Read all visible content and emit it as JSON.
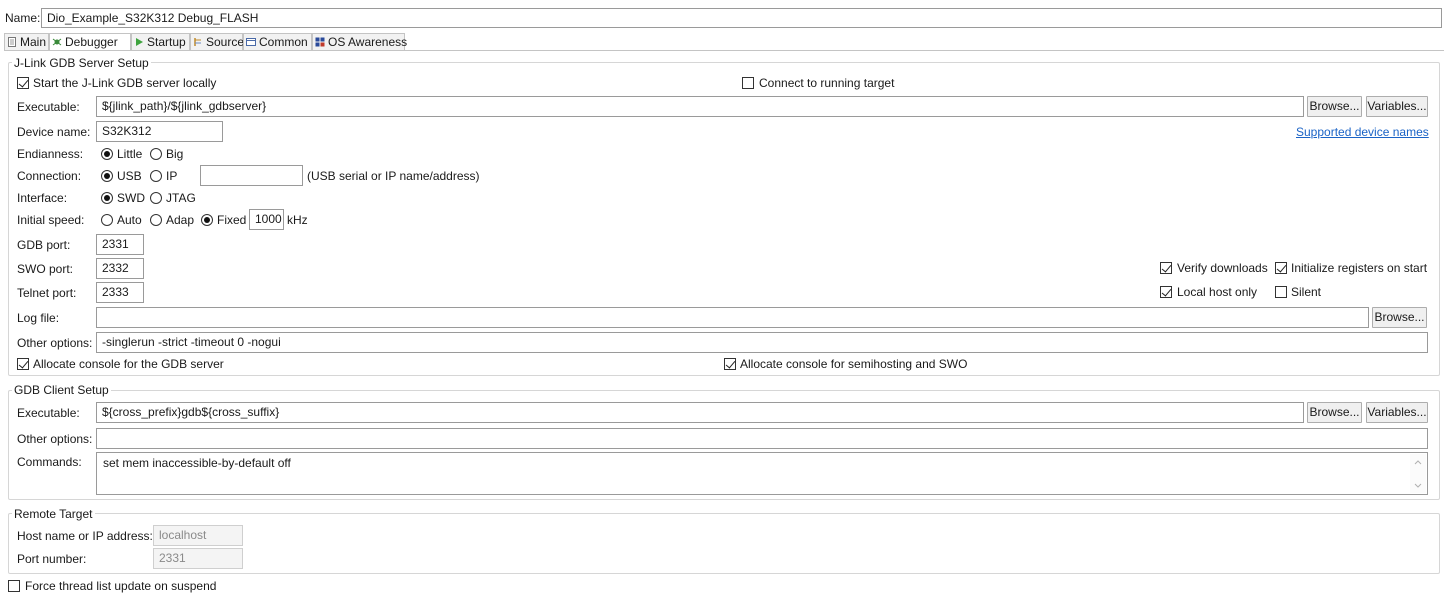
{
  "name": {
    "label": "Name:",
    "value": "Dio_Example_S32K312 Debug_FLASH"
  },
  "tabs": [
    {
      "label": "Main",
      "icon": "main-tab-icon"
    },
    {
      "label": "Debugger",
      "icon": "debugger-tab-icon"
    },
    {
      "label": "Startup",
      "icon": "startup-tab-icon"
    },
    {
      "label": "Source",
      "icon": "source-tab-icon"
    },
    {
      "label": "Common",
      "icon": "common-tab-icon"
    },
    {
      "label": "OS Awareness",
      "icon": "os-awareness-tab-icon"
    }
  ],
  "active_tab": "Debugger",
  "server": {
    "legend": "J-Link GDB Server Setup",
    "start_locally": {
      "label": "Start the J-Link GDB server locally",
      "checked": true
    },
    "connect_running": {
      "label": "Connect to running target",
      "checked": false
    },
    "executable": {
      "label": "Executable:",
      "value": "${jlink_path}/${jlink_gdbserver}"
    },
    "browse": "Browse...",
    "variables": "Variables...",
    "device": {
      "label": "Device name:",
      "value": "S32K312"
    },
    "supported_link": "Supported device names",
    "endianness": {
      "label": "Endianness:",
      "little": "Little",
      "big": "Big",
      "selected": "Little"
    },
    "connection": {
      "label": "Connection:",
      "usb": "USB",
      "ip": "IP",
      "ip_value": "",
      "hint": "(USB serial or IP name/address)",
      "selected": "USB"
    },
    "interface": {
      "label": "Interface:",
      "swd": "SWD",
      "jtag": "JTAG",
      "selected": "SWD"
    },
    "speed": {
      "label": "Initial speed:",
      "auto": "Auto",
      "adap": "Adap",
      "fixed": "Fixed",
      "value": "1000",
      "unit": "kHz",
      "selected": "Fixed"
    },
    "gdb_port": {
      "label": "GDB port:",
      "value": "2331"
    },
    "swo_port": {
      "label": "SWO port:",
      "value": "2332"
    },
    "telnet_port": {
      "label": "Telnet port:",
      "value": "2333"
    },
    "verify_downloads": {
      "label": "Verify downloads",
      "checked": true
    },
    "init_registers": {
      "label": "Initialize registers on start",
      "checked": true
    },
    "local_host_only": {
      "label": "Local host only",
      "checked": true
    },
    "silent": {
      "label": "Silent",
      "checked": false
    },
    "log_file": {
      "label": "Log file:",
      "value": ""
    },
    "log_browse": "Browse...",
    "other_options": {
      "label": "Other options:",
      "value": "-singlerun -strict -timeout 0 -nogui"
    },
    "alloc_console_gdb": {
      "label": "Allocate console for the GDB server",
      "checked": true
    },
    "alloc_console_semi": {
      "label": "Allocate console for semihosting and SWO",
      "checked": true
    }
  },
  "client": {
    "legend": "GDB Client Setup",
    "executable": {
      "label": "Executable:",
      "value": "${cross_prefix}gdb${cross_suffix}"
    },
    "browse": "Browse...",
    "variables": "Variables...",
    "other_options": {
      "label": "Other options:",
      "value": ""
    },
    "commands": {
      "label": "Commands:",
      "value": "set mem inaccessible-by-default off"
    }
  },
  "remote": {
    "legend": "Remote Target",
    "host": {
      "label": "Host name or IP address:",
      "value": "localhost"
    },
    "port": {
      "label": "Port number:",
      "value": "2331"
    }
  },
  "force_thread": {
    "label": "Force thread list update on suspend",
    "checked": false
  },
  "colors": {
    "link": "#1a63c6",
    "border": "#9a9a9a",
    "group_border": "#d6d6d6"
  }
}
